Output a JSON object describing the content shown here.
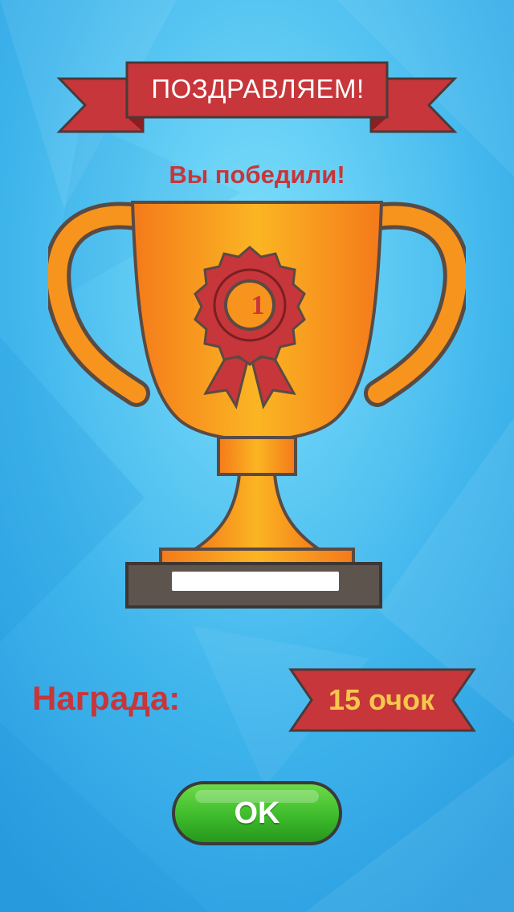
{
  "header": {
    "banner_title": "ПОЗДРАВЛЯЕМ!",
    "subtitle": "Вы победили!"
  },
  "trophy": {
    "medal_number": "1",
    "plaque_text": ""
  },
  "reward": {
    "label": "Награда:",
    "value": "15 очок"
  },
  "actions": {
    "ok_label": "OK"
  },
  "colors": {
    "background": "#47b8ee",
    "ribbon_red": "#c7363a",
    "trophy_orange": "#f7941d",
    "reward_text_gold": "#f7c64d",
    "button_green": "#3dbb2c"
  }
}
